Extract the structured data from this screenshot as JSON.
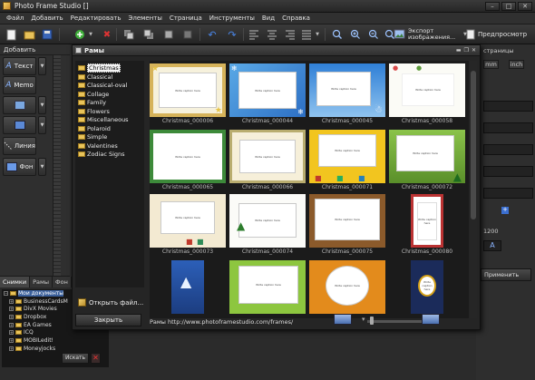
{
  "window": {
    "title": "Photo Frame Studio []"
  },
  "menu": [
    "Файл",
    "Добавить",
    "Редактировать",
    "Элементы",
    "Страница",
    "Инструменты",
    "Вид",
    "Справка"
  ],
  "toolbar": {
    "export_label": "Экспорт изображения...",
    "preview_label": "Предпросмотр"
  },
  "left_panel": {
    "tab_label": "Добавить",
    "tools": [
      {
        "label": "Текст",
        "icon": "text-icon"
      },
      {
        "label": "Memo",
        "icon": "memo-icon"
      },
      {
        "label": "",
        "icon": "image-icon"
      },
      {
        "label": "",
        "icon": "shape-icon"
      },
      {
        "label": "Линия",
        "icon": "line-icon"
      },
      {
        "label": "Фон",
        "icon": "background-icon"
      }
    ]
  },
  "tree": {
    "tabs": [
      "Снимки",
      "Рамы",
      "Фон"
    ],
    "items": [
      {
        "label": "Мои документы",
        "level": 0,
        "selected": true
      },
      {
        "label": "BusinessCardsM",
        "level": 1
      },
      {
        "label": "DivX Movies",
        "level": 1
      },
      {
        "label": "Dropbox",
        "level": 1
      },
      {
        "label": "EA Games",
        "level": 1
      },
      {
        "label": "ICQ",
        "level": 1
      },
      {
        "label": "MOBILedit!",
        "level": 1
      },
      {
        "label": "Moneyjocks",
        "level": 1
      }
    ],
    "search_label": "Искать"
  },
  "right_panel": {
    "tab_label": "страницы",
    "units": [
      "mm",
      "inch"
    ],
    "value": "1200",
    "apply_label": "Применить"
  },
  "dialog": {
    "title": "Рамы",
    "categories": [
      "Christmas",
      "Classical",
      "Classical-oval",
      "Collage",
      "Family",
      "Flowers",
      "Miscellaneous",
      "Polaroid",
      "Simple",
      "Valentines",
      "Zodiac Signs"
    ],
    "selected_category": "Christmas",
    "open_file_label": "Открыть файл...",
    "close_label": "Закрыть",
    "status_text": "Рамы http://www.photoframestudio.com/frames/",
    "thumbnails": [
      {
        "label": "Christmas_000006",
        "style": "gold-stars"
      },
      {
        "label": "Christmas_000044",
        "style": "blue-snowflakes"
      },
      {
        "label": "Christmas_000045",
        "style": "blue-snowman"
      },
      {
        "label": "Christmas_000058",
        "style": "white-ornaments"
      },
      {
        "label": "Christmas_000065",
        "style": "green-holly"
      },
      {
        "label": "Christmas_000066",
        "style": "beige-ivy"
      },
      {
        "label": "Christmas_000071",
        "style": "yellow-gifts"
      },
      {
        "label": "Christmas_000072",
        "style": "green-tree"
      },
      {
        "label": "Christmas_000073",
        "style": "beige-gifts"
      },
      {
        "label": "Christmas_000074",
        "style": "white-tree"
      },
      {
        "label": "Christmas_000075",
        "style": "brown-frame"
      },
      {
        "label": "Christmas_000080",
        "style": "portrait-red"
      },
      {
        "label": "",
        "style": "portrait-blue-tree"
      },
      {
        "label": "",
        "style": "green-lime"
      },
      {
        "label": "",
        "style": "orange-circle"
      },
      {
        "label": "",
        "style": "portrait-navy-ornament"
      }
    ],
    "placeholder_text": "Write caption here"
  },
  "colors": {
    "app_bg": "#2b2b2b",
    "dialog_bg": "#252525",
    "accent": "#3a5f9a"
  }
}
